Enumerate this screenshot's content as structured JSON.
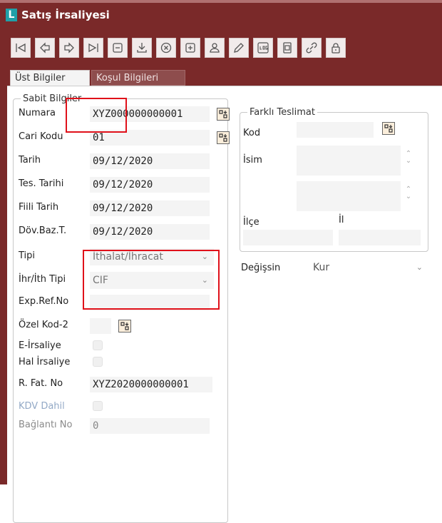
{
  "window": {
    "title": "Satış İrsaliyesi",
    "logo_letter": "L"
  },
  "toolbar": {
    "buttons": [
      "first-icon",
      "prev-icon",
      "next-icon",
      "last-icon",
      "edit-record-icon",
      "download-icon",
      "cancel-icon",
      "add-document-icon",
      "user-icon",
      "pencil-icon",
      "log-icon",
      "document-icon",
      "link-icon",
      "lock-icon"
    ]
  },
  "tabs": [
    {
      "label": "Üst Bilgiler",
      "active": true
    },
    {
      "label": "Koşul Bilgileri",
      "active": false
    }
  ],
  "sabit": {
    "legend": "Sabit Bilgiler",
    "numara": {
      "label": "Numara",
      "value": "XYZ000000000001"
    },
    "cari_kodu": {
      "label": "Cari Kodu",
      "value": "01"
    },
    "tarih": {
      "label": "Tarih",
      "value": "09/12/2020"
    },
    "tes_tarihi": {
      "label": "Tes. Tarihi",
      "value": "09/12/2020"
    },
    "fiili_tarih": {
      "label": "Fiili Tarih",
      "value": "09/12/2020"
    },
    "dov_baz_t": {
      "label": "Döv.Baz.T.",
      "value": "09/12/2020"
    },
    "tipi": {
      "label": "Tipi",
      "value": "İthalat/İhracat"
    },
    "ihr_ith_tipi": {
      "label": "İhr/İth Tipi",
      "value": "CIF"
    },
    "exp_ref_no": {
      "label": "Exp.Ref.No",
      "value": ""
    },
    "ozel_kod_2": {
      "label": "Özel Kod-2",
      "value": ""
    },
    "e_irsaliye": {
      "label": "E-İrsaliye"
    },
    "hal_irsaliye": {
      "label": "Hal İrsaliye"
    },
    "r_fat_no": {
      "label": "R. Fat. No",
      "value": "XYZ2020000000001"
    },
    "kdv_dahil": {
      "label": "KDV Dahil"
    },
    "baglanti_no": {
      "label": "Bağlantı No",
      "value": "0"
    }
  },
  "farkli": {
    "legend": "Farklı Teslimat",
    "kod": {
      "label": "Kod",
      "value": ""
    },
    "isim": {
      "label": "İsim",
      "value": ""
    },
    "ilce": {
      "label": "İlçe",
      "value": ""
    },
    "il": {
      "label": "İl",
      "value": ""
    }
  },
  "degissin": {
    "label": "Değişsin",
    "value": "Kur"
  },
  "colors": {
    "titlebar": "#7a2929",
    "highlight": "#e0111a",
    "accent": "#20a0a8"
  }
}
